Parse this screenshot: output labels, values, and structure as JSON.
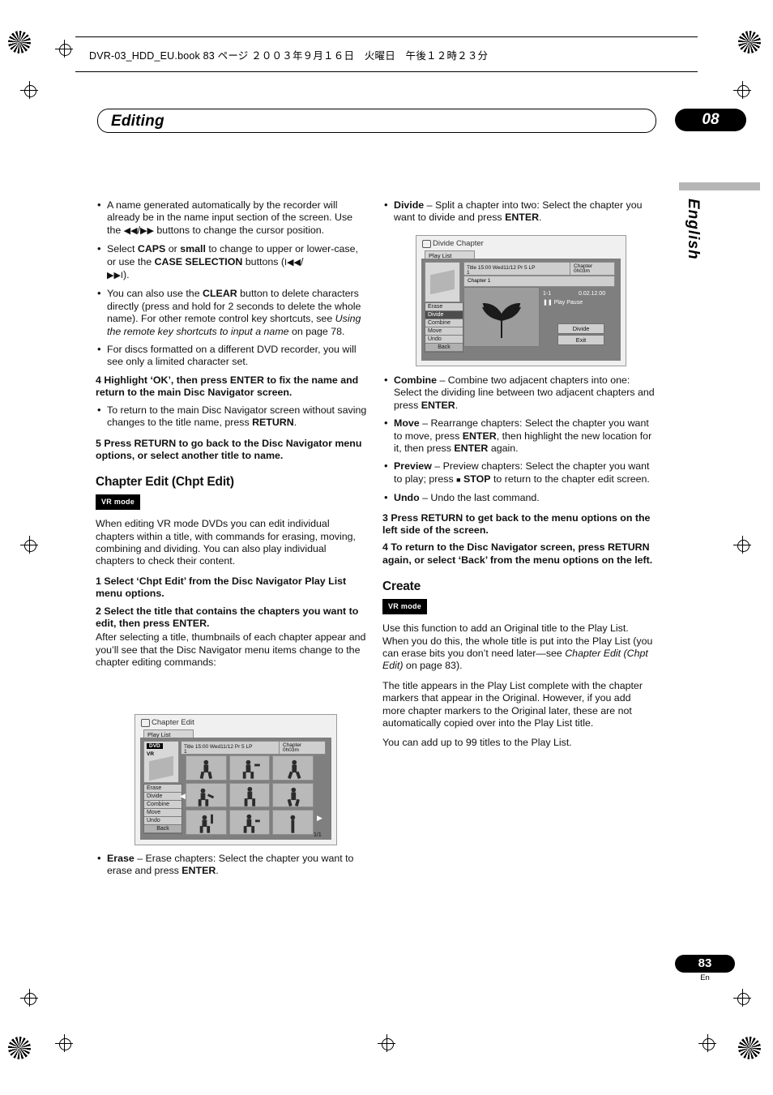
{
  "header": {
    "book_line": "DVR-03_HDD_EU.book 83 ページ ２００３年９月１６日　火曜日　午後１２時２３分",
    "chapter_title": "Editing",
    "chapter_number": "08",
    "language_tab": "English"
  },
  "footer": {
    "page_number": "83",
    "page_suffix": "En"
  },
  "left_column": {
    "bullets_top": [
      "A name generated automatically by the recorder will already be in the name input section of the screen. Use the ◀◀/▶▶ buttons to change the cursor position.",
      "Select CAPS or small to change to upper or lower-case, or use the CASE SELECTION buttons (I◀◀/▶▶I).",
      "You can also use the CLEAR button to delete characters directly (press and hold for 2 seconds to delete the whole name). For other remote control key shortcuts, see Using the remote key shortcuts to input a name on page 78.",
      "For discs formatted on a different DVD recorder, you will see only a limited character set."
    ],
    "step4": "4  Highlight ‘OK’, then press ENTER to fix the name and return to the main Disc Navigator screen.",
    "step4_bullet": "To return to the main Disc Navigator screen without saving changes to the title name, press RETURN.",
    "step5": "5  Press RETURN to go back to the Disc Navigator menu options, or select another title to name.",
    "section_title": "Chapter Edit (Chpt Edit)",
    "vr_badge": "VR mode",
    "intro": "When editing VR mode DVDs you can edit individual chapters within a title, with commands for erasing, moving, combining and dividing. You can also play individual chapters to check their content.",
    "step1": "1  Select ‘Chpt Edit’ from the Disc Navigator Play List menu options.",
    "step2": "2  Select the title that contains the chapters you want to edit, then press ENTER.",
    "step2_body": "After selecting a title, thumbnails of each chapter appear and you’ll see that the Disc Navigator menu items change to the chapter editing commands:",
    "erase_bullet": "Erase – Erase chapters: Select the chapter you want to erase and press ENTER."
  },
  "right_column": {
    "divide_bullet": "Divide – Split a chapter into two: Select the chapter you want to divide and press ENTER.",
    "bullets": [
      "Combine – Combine two adjacent chapters into one: Select the dividing line between two adjacent chapters and press ENTER.",
      "Move – Rearrange chapters: Select the chapter you want to move, press ENTER, then highlight the new location for it, then press ENTER again.",
      "Preview – Preview chapters: Select the chapter you want to play; press ■ STOP to return to the chapter edit screen.",
      "Undo – Undo the last command."
    ],
    "step3": "3  Press RETURN to get back to the menu options on the left side of the screen.",
    "step4": "4  To return to the Disc Navigator screen, press RETURN again, or select ‘Back’ from the menu options on the left.",
    "section_title": "Create",
    "vr_badge": "VR mode",
    "para1": "Use this function to add an Original title to the Play List. When you do this, the whole title is put into the Play List (you can erase bits you don’t need later—see Chapter Edit (Chpt Edit) on page 83).",
    "para2": "The title appears in the Play List complete with the chapter markers that appear in the Original. However, if you add more chapter markers to the Original later, these are not automatically copied over into the Play List title.",
    "para3": "You can add up to 99 titles to the Play List."
  },
  "osd_chapter_edit": {
    "window_title": "Chapter Edit",
    "playlist_tab": "Play List",
    "disc_badge": "DVD",
    "vr_badge": "VR",
    "title_bar": "Title  15:00 Wed11/12  Pr 5   LP",
    "title_num": "1",
    "chapter_label": "Chapter",
    "chapter_time": "0h03m",
    "menu_items": [
      "Erase",
      "Divide",
      "Combine",
      "Move",
      "Undo"
    ],
    "back_label": "Back",
    "page_indicator": "1/1"
  },
  "osd_divide_chapter": {
    "window_title": "Divide Chapter",
    "playlist_tab": "Play List",
    "title_bar": "Title  15:00 Wed11/12  Pr 5   LP",
    "title_num": "1",
    "chapter_label": "Chapter",
    "chapter_time": "0h03m",
    "chapter_line": "Chapter    1",
    "counter_left": "1-1",
    "counter_right": "0.02.12.00",
    "play_state": "Play Pause",
    "menu_items": [
      "Erase",
      "Divide",
      "Combine",
      "Move",
      "Undo"
    ],
    "back_label": "Back",
    "divide_button": "Divide",
    "exit_button": "Exit"
  }
}
